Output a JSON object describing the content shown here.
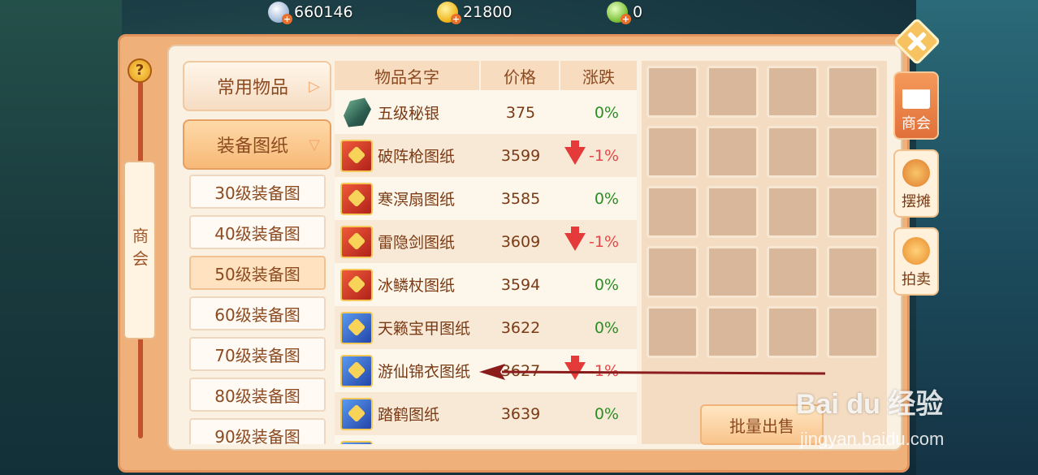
{
  "currency": {
    "silver": "660146",
    "gold": "21800",
    "jade": "0",
    "plus": "+"
  },
  "sidebar_left": {
    "help_label": "?",
    "title": "商会"
  },
  "categories": {
    "common": "常用物品",
    "equip_blueprints": "装备图纸",
    "expand_arrow": "▷",
    "collapse_arrow": "▽",
    "levels": [
      "30级装备图",
      "40级装备图",
      "50级装备图",
      "60级装备图",
      "70级装备图",
      "80级装备图",
      "90级装备图"
    ]
  },
  "table": {
    "headers": [
      "物品名字",
      "价格",
      "涨跌"
    ],
    "rows": [
      {
        "name": "五级秘银",
        "price": "375",
        "change": "0%",
        "trend": "flat",
        "icon": "ore-icon"
      },
      {
        "name": "破阵枪图纸",
        "price": "3599",
        "change": "-1%",
        "trend": "down",
        "icon": "red-book-icon"
      },
      {
        "name": "寒溟扇图纸",
        "price": "3585",
        "change": "0%",
        "trend": "flat",
        "icon": "red-book-icon"
      },
      {
        "name": "雷隐剑图纸",
        "price": "3609",
        "change": "-1%",
        "trend": "down",
        "icon": "red-book-icon"
      },
      {
        "name": "冰鳞杖图纸",
        "price": "3594",
        "change": "0%",
        "trend": "flat",
        "icon": "red-book-icon"
      },
      {
        "name": "天籁宝甲图纸",
        "price": "3622",
        "change": "0%",
        "trend": "flat",
        "icon": "blue-book-icon"
      },
      {
        "name": "游仙锦衣图纸",
        "price": "3627",
        "change": "-1%",
        "trend": "down",
        "icon": "blue-book-icon"
      },
      {
        "name": "踏鹤图纸",
        "price": "3639",
        "change": "0%",
        "trend": "flat",
        "icon": "blue-book-icon"
      }
    ]
  },
  "inventory": {
    "sell_button": "批量出售"
  },
  "side_tabs": [
    {
      "label": "商会",
      "active": true
    },
    {
      "label": "摆摊",
      "active": false
    },
    {
      "label": "拍卖",
      "active": false
    }
  ],
  "watermark": {
    "main": "Bai du 经验",
    "sub": "jingyan.baidu.com"
  },
  "colors": {
    "flat": "#2a8f24",
    "down": "#e34848",
    "panel": "#f0b07a",
    "annotation": "#8a1c1c"
  }
}
